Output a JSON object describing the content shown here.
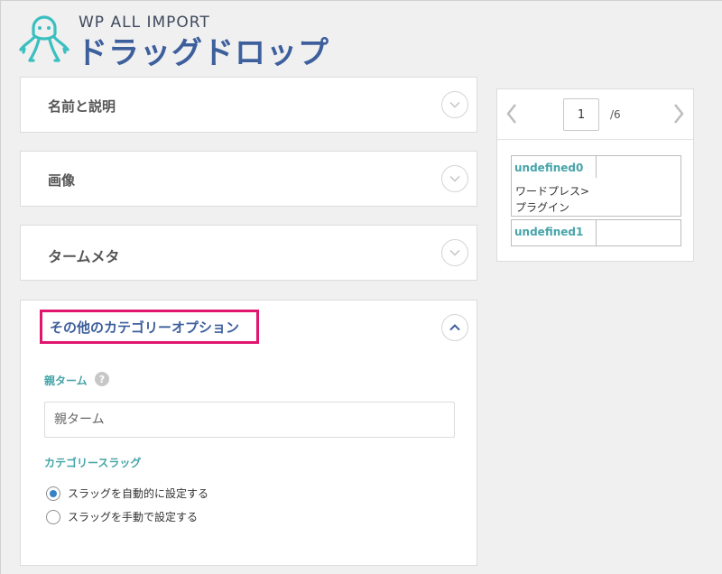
{
  "brand": {
    "small": "WP ALL IMPORT",
    "big": "ドラッグドロップ",
    "accent_color": "#3d5f9c",
    "logo_color": "#3bbfbf"
  },
  "sections": [
    {
      "title": "名前と説明",
      "state": "collapsed",
      "icon": "chevron-down-icon"
    },
    {
      "title": "画像",
      "state": "collapsed",
      "icon": "chevron-down-icon"
    },
    {
      "title": "タームメタ",
      "state": "collapsed",
      "icon": "chevron-down-icon"
    },
    {
      "title": "その他のカテゴリーオプション",
      "state": "expanded",
      "icon": "chevron-up-icon"
    }
  ],
  "other_options": {
    "parent_label": "親ターム",
    "help_icon": "?",
    "parent_placeholder": "親ターム",
    "slug_label": "カテゴリースラッグ",
    "slug_options": [
      {
        "label": "スラッグを自動的に設定する",
        "checked": true
      },
      {
        "label": "スラッグを手動で設定する",
        "checked": false
      }
    ],
    "highlight_color": "#e0156e",
    "label_color": "#46a4a8"
  },
  "preview": {
    "current_page": "1",
    "total_pages": "/6",
    "nodes": [
      {
        "tag": "undefined0",
        "value": "ワードプレス>\nプラグイン"
      },
      {
        "tag": "undefined1",
        "value": ""
      }
    ]
  }
}
